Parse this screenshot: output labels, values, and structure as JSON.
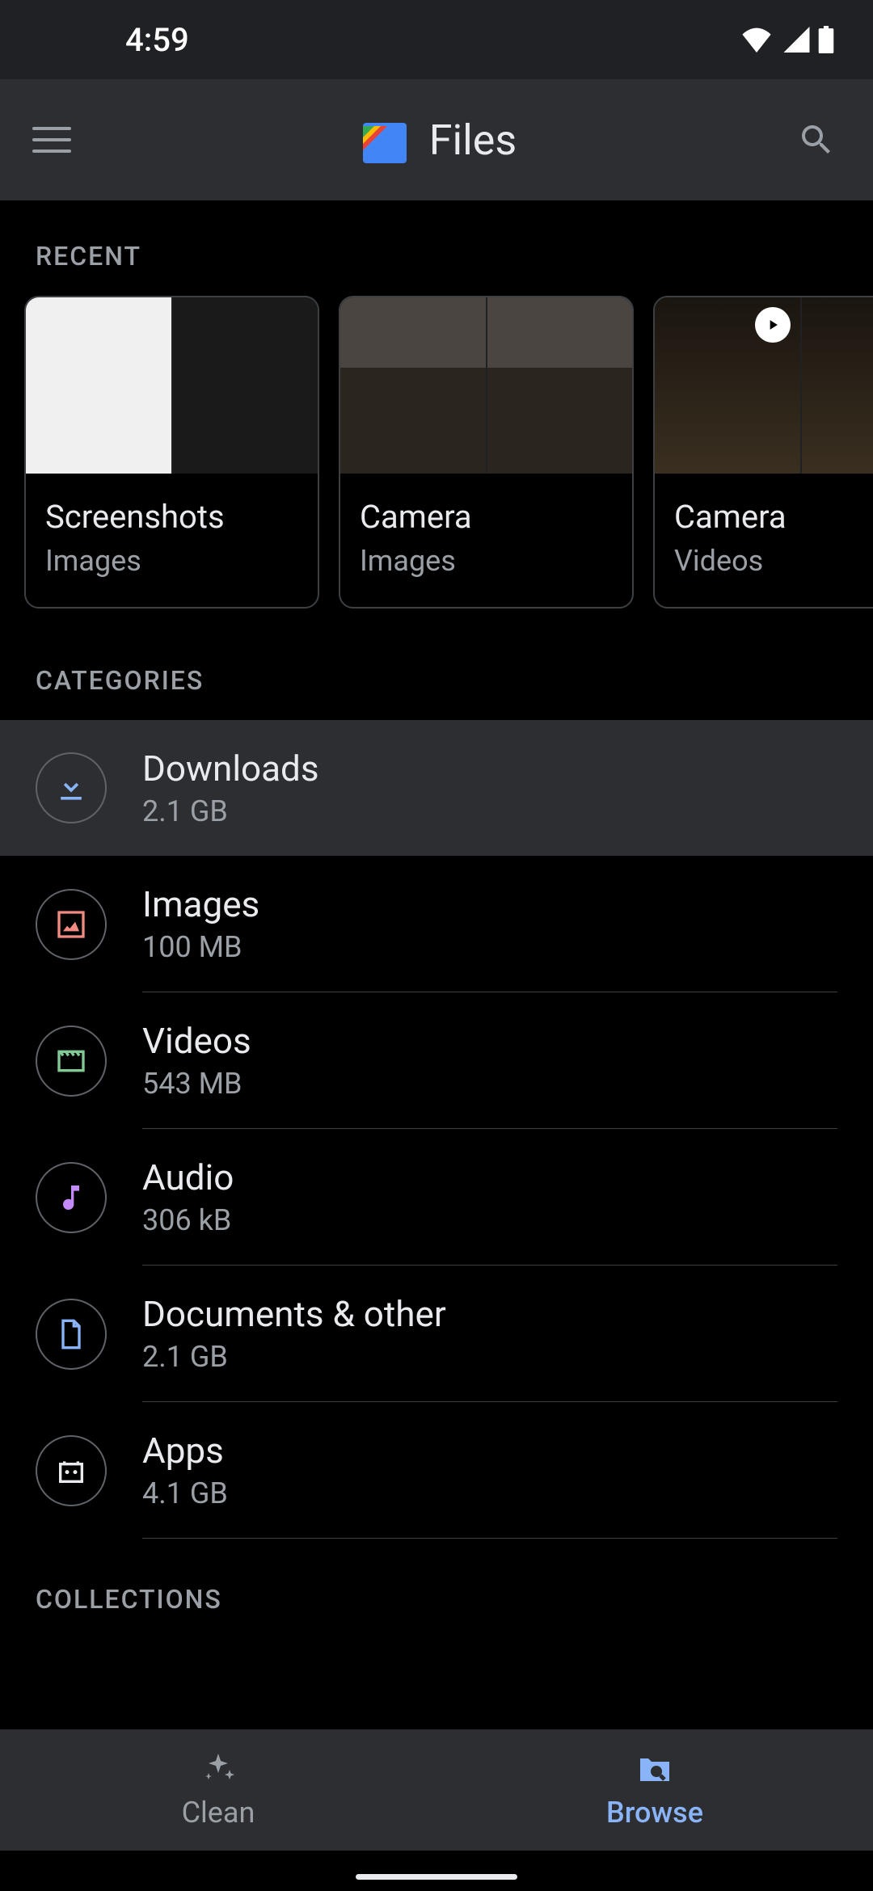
{
  "status": {
    "time": "4:59"
  },
  "app": {
    "title": "Files"
  },
  "sections": {
    "recent": "RECENT",
    "categories": "CATEGORIES",
    "collections": "COLLECTIONS"
  },
  "recent": [
    {
      "title": "Screenshots",
      "subtitle": "Images"
    },
    {
      "title": "Camera",
      "subtitle": "Images"
    },
    {
      "title": "Camera",
      "subtitle": "Videos"
    }
  ],
  "categories": [
    {
      "title": "Downloads",
      "size": "2.1 GB",
      "icon": "download",
      "color": "#8ab4f8"
    },
    {
      "title": "Images",
      "size": "100 MB",
      "icon": "image",
      "color": "#f28b82"
    },
    {
      "title": "Videos",
      "size": "543 MB",
      "icon": "video",
      "color": "#81c995"
    },
    {
      "title": "Audio",
      "size": "306 kB",
      "icon": "audio",
      "color": "#c58af9"
    },
    {
      "title": "Documents & other",
      "size": "2.1 GB",
      "icon": "document",
      "color": "#8ab4f8"
    },
    {
      "title": "Apps",
      "size": "4.1 GB",
      "icon": "apps",
      "color": "#e8eaed"
    }
  ],
  "nav": {
    "clean": "Clean",
    "browse": "Browse"
  }
}
